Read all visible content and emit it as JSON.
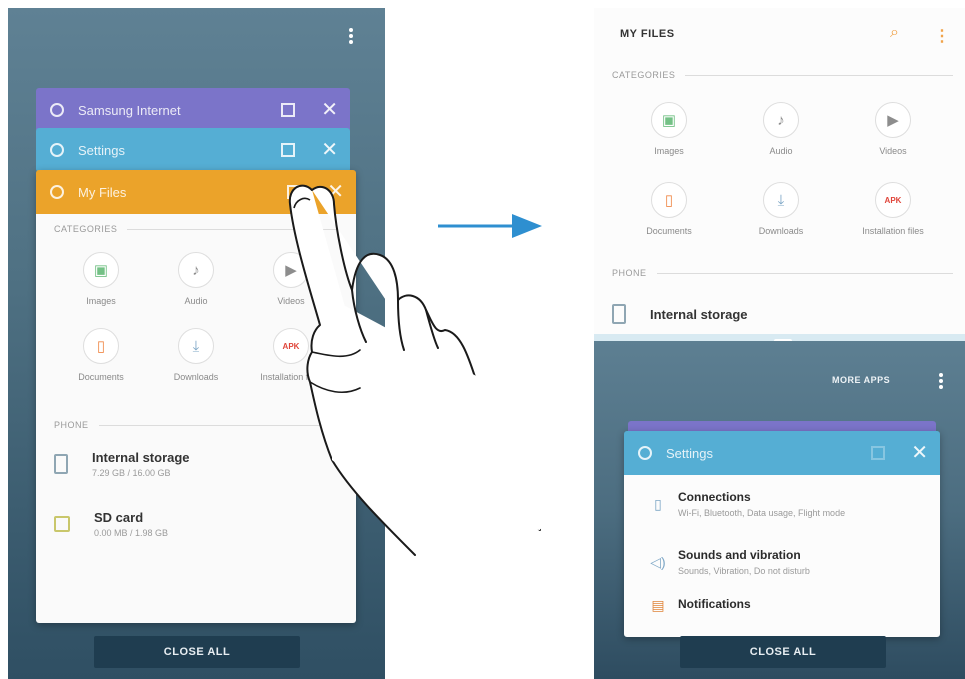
{
  "left": {
    "cards": [
      {
        "title": "Samsung Internet",
        "color": "#7b74c9"
      },
      {
        "title": "Settings",
        "color": "#55aed4"
      },
      {
        "title": "My Files",
        "color": "#eba32a"
      }
    ],
    "my_files": {
      "categories_label": "CATEGORIES",
      "categories": [
        {
          "label": "Images",
          "icon": "image-icon",
          "glyph": "▣",
          "color": "#74c186"
        },
        {
          "label": "Audio",
          "icon": "music-note-icon",
          "glyph": "♪",
          "color": "#8d8d8d"
        },
        {
          "label": "Videos",
          "icon": "video-icon",
          "glyph": "▶",
          "color": "#8d8d8d"
        },
        {
          "label": "Documents",
          "icon": "document-icon",
          "glyph": "▯",
          "color": "#f08a4b"
        },
        {
          "label": "Downloads",
          "icon": "download-icon",
          "glyph": "⤓",
          "color": "#7ea7c6"
        },
        {
          "label": "Installation files",
          "icon": "apk-icon",
          "glyph": "APK",
          "color": "#e0453a"
        }
      ],
      "phone_label": "PHONE",
      "storage": [
        {
          "title": "Internal storage",
          "sub": "7.29 GB / 16.00 GB"
        },
        {
          "title": "SD card",
          "sub": "0.00 MB / 1.98 GB"
        }
      ]
    },
    "close_all": "CLOSE ALL"
  },
  "right": {
    "my_files": {
      "title": "MY FILES",
      "categories_label": "CATEGORIES",
      "categories": [
        {
          "label": "Images",
          "icon": "image-icon",
          "glyph": "▣",
          "color": "#74c186"
        },
        {
          "label": "Audio",
          "icon": "music-note-icon",
          "glyph": "♪",
          "color": "#8d8d8d"
        },
        {
          "label": "Videos",
          "icon": "video-icon",
          "glyph": "▶",
          "color": "#8d8d8d"
        },
        {
          "label": "Documents",
          "icon": "document-icon",
          "glyph": "▯",
          "color": "#f08a4b"
        },
        {
          "label": "Downloads",
          "icon": "download-icon",
          "glyph": "⤓",
          "color": "#7ea7c6"
        },
        {
          "label": "Installation files",
          "icon": "apk-icon",
          "glyph": "APK",
          "color": "#e0453a"
        }
      ],
      "phone_label": "PHONE",
      "storage_title": "Internal storage"
    },
    "more_apps": "MORE APPS",
    "settings_card": {
      "title": "Settings",
      "color": "#55aed4",
      "rows": [
        {
          "title": "Connections",
          "sub": "Wi-Fi, Bluetooth, Data usage, Flight mode",
          "icon": "connections-icon",
          "glyph": "▯"
        },
        {
          "title": "Sounds and vibration",
          "sub": "Sounds, Vibration, Do not disturb",
          "icon": "speaker-icon",
          "glyph": "◁)"
        },
        {
          "title": "Notifications",
          "sub": "",
          "icon": "notifications-icon",
          "glyph": "▤"
        }
      ]
    },
    "close_all": "CLOSE ALL"
  },
  "colors": {
    "arrow": "#2e8fd0",
    "close_all_bg": "#1f3d50"
  }
}
